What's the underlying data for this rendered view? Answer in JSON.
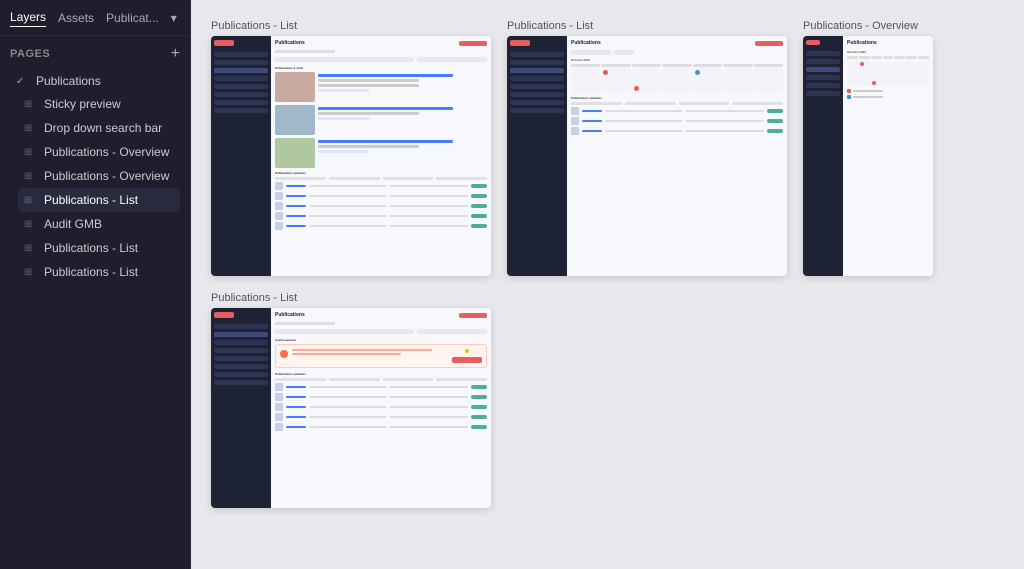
{
  "header": {
    "layers_tab": "Layers",
    "assets_tab": "Assets",
    "publications_tab": "Publicat...",
    "more_icon": "▾"
  },
  "sidebar": {
    "pages_title": "PAGES",
    "add_icon": "+",
    "pages": [
      {
        "id": "publications",
        "label": "Publications",
        "indent": 0,
        "type": "parent",
        "expanded": true
      },
      {
        "id": "sticky-preview",
        "label": "Sticky preview",
        "indent": 1,
        "type": "child"
      },
      {
        "id": "drop-down-search",
        "label": "Drop down search bar",
        "indent": 1,
        "type": "child"
      },
      {
        "id": "publications-overview-1",
        "label": "Publications - Overview",
        "indent": 1,
        "type": "child"
      },
      {
        "id": "publications-overview-2",
        "label": "Publications - Overview",
        "indent": 1,
        "type": "child"
      },
      {
        "id": "publications-list-1",
        "label": "Publications - List",
        "indent": 1,
        "type": "child"
      },
      {
        "id": "audit-gmb",
        "label": "Audit GMB",
        "indent": 1,
        "type": "child"
      },
      {
        "id": "publications-list-2",
        "label": "Publications - List",
        "indent": 1,
        "type": "child"
      },
      {
        "id": "publications-list-3",
        "label": "Publications - List",
        "indent": 1,
        "type": "child"
      }
    ]
  },
  "main": {
    "frames": [
      {
        "id": "frame-top-left",
        "label": "Publications - List",
        "type": "list-with-cards"
      },
      {
        "id": "frame-top-middle",
        "label": "Publications - List",
        "type": "list-calendar"
      },
      {
        "id": "frame-top-right",
        "label": "Publications - Overview",
        "type": "overview-calendar"
      },
      {
        "id": "frame-bottom-left",
        "label": "Publications - List",
        "type": "list-with-alert"
      }
    ]
  }
}
